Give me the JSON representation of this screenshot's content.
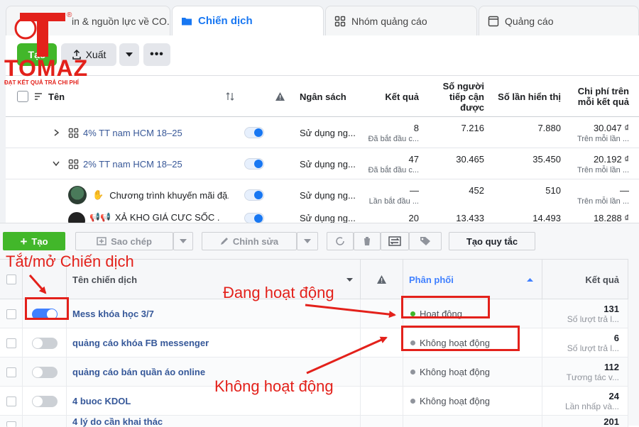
{
  "logo": {
    "word": "TOMAZ",
    "tagline": "ĐẠT KẾT QUẢ TRẢ CHI PHÍ",
    "mark": "®"
  },
  "top": {
    "tabs": [
      {
        "label": "in & nguồn lực về CO...",
        "icon": "account-icon"
      },
      {
        "label": "Chiến dịch",
        "icon": "folder-icon"
      },
      {
        "label": "Nhóm quảng cáo",
        "icon": "grid-icon"
      },
      {
        "label": "Quảng cáo",
        "icon": "ad-icon"
      }
    ],
    "toolbar": {
      "create": "Tạo",
      "export": "Xuất",
      "more": "•••"
    },
    "columns": {
      "name": "Tên",
      "budget": "Ngân sách",
      "results": "Kết quả",
      "reach": "Số người tiếp cận được",
      "impressions": "Số lần hiển thị",
      "cost": "Chi phí trên mỗi kết quả"
    },
    "rows": [
      {
        "name": "4% TT nam HCM 18–25",
        "budget": "Sử dụng ng...",
        "results": "8",
        "results_sub": "Đã bắt đầu c...",
        "reach": "7.216",
        "impressions": "7.880",
        "cost": "30.047 ₫",
        "cost_sub": "Trên mỗi lần ..."
      },
      {
        "name": "2% TT nam HCM 18–25",
        "budget": "Sử dụng ng...",
        "results": "47",
        "results_sub": "Đã bắt đầu c...",
        "reach": "30.465",
        "impressions": "35.450",
        "cost": "20.192 ₫",
        "cost_sub": "Trên mỗi lần ..."
      },
      {
        "name": "Chương trình khuyến mãi đặ...",
        "budget": "Sử dụng ng...",
        "results": "—",
        "results_sub": "Lần bắt đầu ...",
        "reach": "452",
        "impressions": "510",
        "cost": "—",
        "cost_sub": "Trên mỗi lần ..."
      },
      {
        "name": "XẢ KHO GIÁ CƯC SỐC .",
        "budget": "Sử dụng ng...",
        "results": "20",
        "results_sub": "",
        "reach": "13.433",
        "impressions": "14.493",
        "cost": "18.288 ₫",
        "cost_sub": ""
      }
    ]
  },
  "bottom": {
    "toolbar": {
      "create": "Tạo",
      "duplicate": "Sao chép",
      "edit": "Chỉnh sửa",
      "rules": "Tạo quy tắc"
    },
    "columns": {
      "name": "Tên chiến dịch",
      "delivery": "Phân phối",
      "results": "Kết quả"
    },
    "rows": [
      {
        "name": "Mess khóa học 3/7",
        "on": true,
        "delivery": "Hoạt động",
        "results": "131",
        "results_sub": "Số lượt trả l..."
      },
      {
        "name": "quảng cáo khóa FB messenger",
        "on": false,
        "delivery": "Không hoạt động",
        "results": "6",
        "results_sub": "Số lượt trả l..."
      },
      {
        "name": "quảng cáo bán quần áo online",
        "on": false,
        "delivery": "Không hoạt động",
        "results": "112",
        "results_sub": "Tương tác v..."
      },
      {
        "name": "4 buoc KDOL",
        "on": false,
        "delivery": "Không hoạt động",
        "results": "24",
        "results_sub": "Lần nhấp và..."
      },
      {
        "name": "4 lý do cần khai thác",
        "on": false,
        "delivery": "",
        "results": "201",
        "results_sub": ""
      }
    ]
  },
  "annotations": {
    "toggle": "Tắt/mở Chiến dịch",
    "active": "Đang hoạt động",
    "inactive": "Không hoạt động"
  },
  "colors": {
    "accent": "#1877f2",
    "annotation": "#e3211b",
    "create": "#42b72a"
  }
}
